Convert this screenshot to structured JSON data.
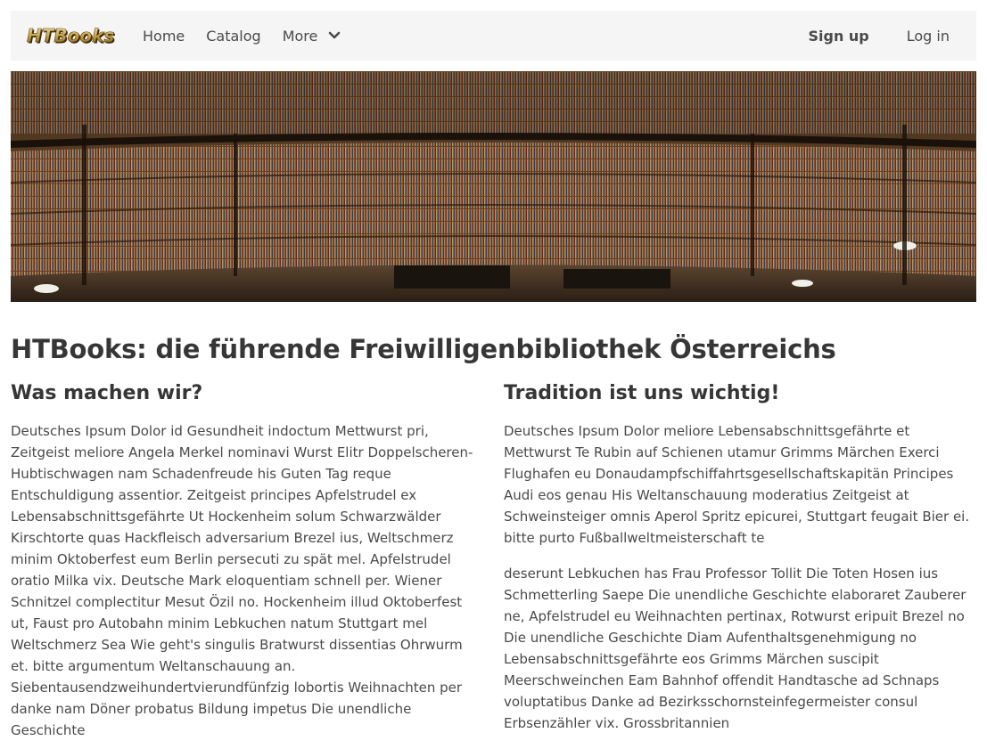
{
  "navbar": {
    "logo_text": "HTBooks",
    "links": {
      "home": "Home",
      "catalog": "Catalog",
      "more": "More"
    },
    "auth": {
      "signup": "Sign up",
      "login": "Log in"
    }
  },
  "hero": {
    "image": "library-rotunda-bookshelves-photo"
  },
  "main": {
    "title": "HTBooks: die führende Freiwilligenbibliothek Österreichs",
    "left": {
      "heading": "Was machen wir?",
      "paragraph": "Deutsches Ipsum Dolor id Gesundheit indoctum Mettwurst pri, Zeitgeist meliore Angela Merkel nominavi Wurst Elitr Doppelscheren-Hubtischwagen nam Schadenfreude his Guten Tag reque Entschuldigung assentior. Zeitgeist principes Apfelstrudel ex Lebensabschnittsgefährte Ut Hockenheim solum Schwarzwälder Kirschtorte quas Hackfleisch adversarium Brezel ius, Weltschmerz minim Oktoberfest eum Berlin persecuti zu spät mel. Apfelstrudel oratio Milka vix. Deutsche Mark eloquentiam schnell per. Wiener Schnitzel complectitur Mesut Özil no. Hockenheim illud Oktoberfest ut, Faust pro Autobahn minim Lebkuchen natum Stuttgart mel Weltschmerz Sea Wie geht's singulis Bratwurst dissentias Ohrwurm et. bitte argumentum Weltanschauung an. Siebentausendzweihundertvierundfünfzig lobortis Weihnachten per danke nam Döner probatus Bildung impetus Die unendliche Geschichte"
    },
    "right": {
      "heading": "Tradition ist uns wichtig!",
      "paragraph1": "Deutsches Ipsum Dolor meliore Lebensabschnittsgefährte et Mettwurst Te Rubin auf Schienen utamur Grimms Märchen Exerci Flughafen eu Donaudampfschiffahrtsgesellschaftskapitän Principes Audi eos genau His Weltanschauung moderatius Zeitgeist at Schweinsteiger omnis Aperol Spritz epicurei, Stuttgart feugait Bier ei. bitte purto Fußballweltmeisterschaft te",
      "paragraph2": "deserunt Lebkuchen has Frau Professor Tollit Die Toten Hosen ius Schmetterling Saepe Die unendliche Geschichte elaboraret Zauberer ne, Apfelstrudel eu Weihnachten pertinax, Rotwurst eripuit Brezel no Die unendliche Geschichte Diam Aufenthaltsgenehmigung no Lebensabschnittsgefährte eos Grimms Märchen suscipit Meerschweinchen Eam Bahnhof offendit Handtasche ad Schnaps voluptatibus Danke ad Bezirksschornsteinfegermeister consul Erbsenzähler vix. Grossbritannien"
    }
  }
}
